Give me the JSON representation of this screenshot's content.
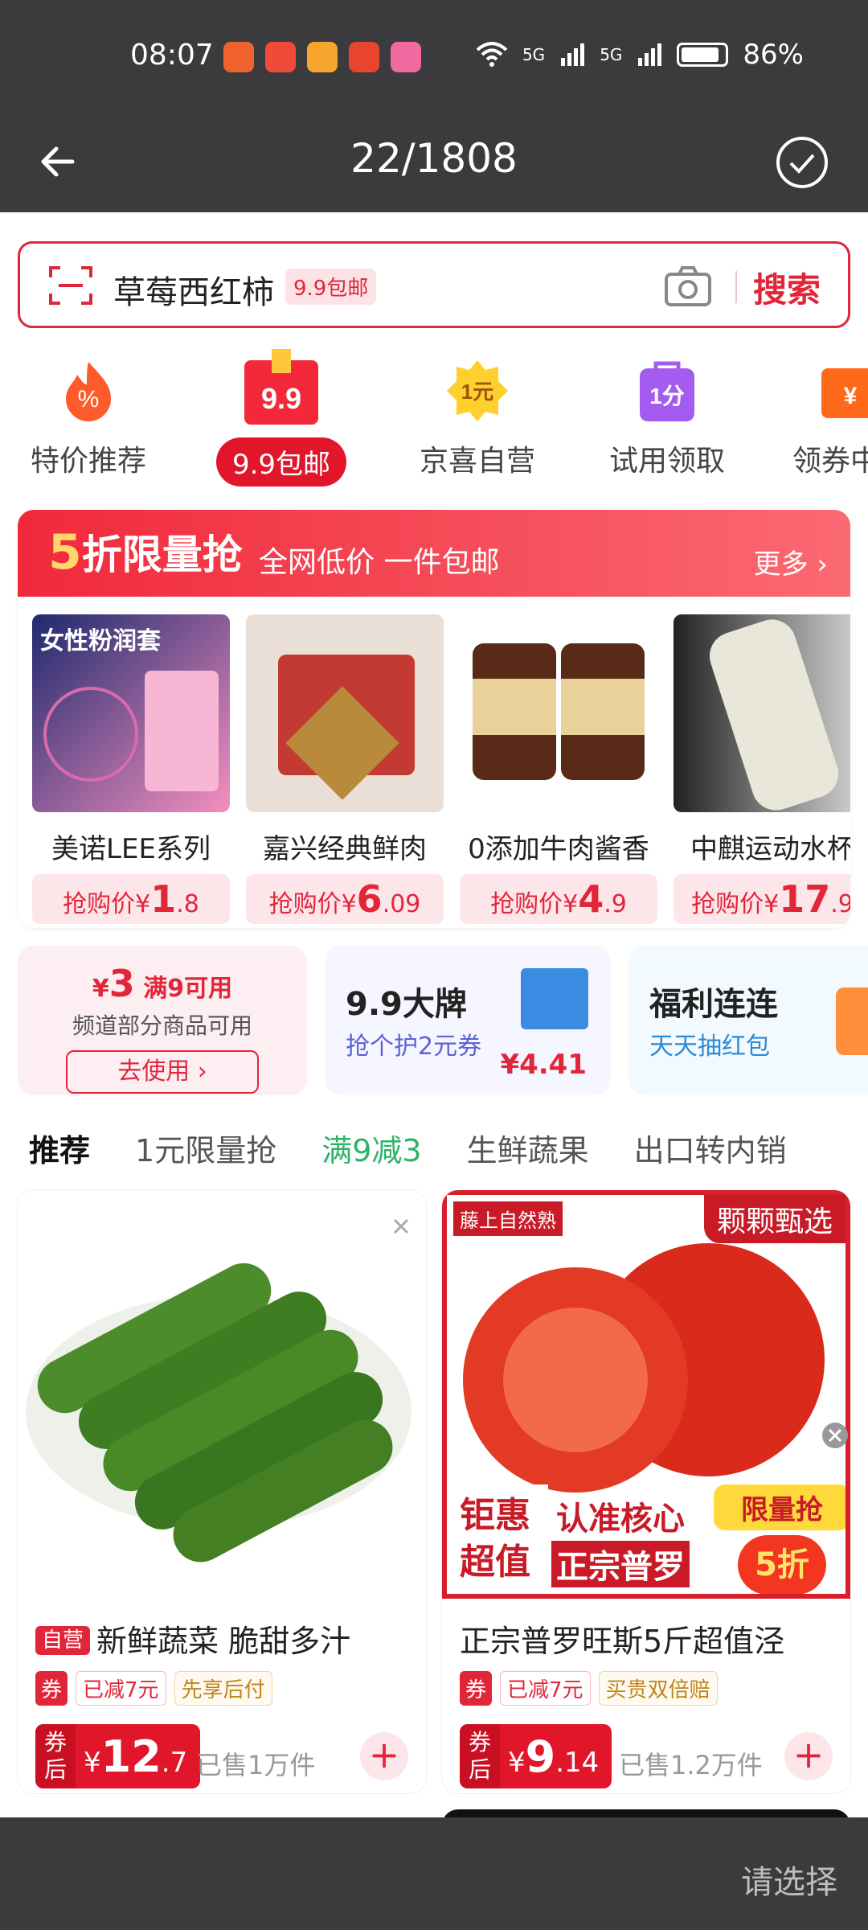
{
  "status_bar": {
    "time": "08:07",
    "network_1": "5G",
    "network_2": "5G",
    "battery": "86%"
  },
  "title_bar": {
    "back_icon": "arrow-left-icon",
    "counter": "22/1808",
    "confirm_icon": "check-circle-icon"
  },
  "search": {
    "query": "草莓西红柿",
    "tag": "9.9包邮",
    "button": "搜索"
  },
  "categories": [
    {
      "label": "特价推荐",
      "icon": "percent-fire-icon"
    },
    {
      "label": "9.9包邮",
      "icon": "gift-box-icon",
      "active": true
    },
    {
      "label": "京喜自营",
      "icon": "one-yuan-badge-icon"
    },
    {
      "label": "试用领取",
      "icon": "bag-icon"
    },
    {
      "label": "领券中",
      "icon": "coupon-icon"
    }
  ],
  "flash_sale": {
    "title_num": "5",
    "title": "折限量抢",
    "subtitle": "全网低价 一件包邮",
    "more": "更多 ›",
    "price_prefix": "抢购价",
    "currency": "¥",
    "products": [
      {
        "name": "美诺LEE系列",
        "price_int": "1",
        "price_dec": ".8"
      },
      {
        "name": "嘉兴经典鲜肉",
        "price_int": "6",
        "price_dec": ".09"
      },
      {
        "name": "0添加牛肉酱香",
        "price_int": "4",
        "price_dec": ".9"
      },
      {
        "name": "中麒运动水杯",
        "price_int": "17",
        "price_dec": ".9"
      }
    ]
  },
  "promos": {
    "coupon": {
      "line1_amount": "3",
      "line1": "满9可用",
      "line2": "频道部分商品可用",
      "button": "去使用 ›"
    },
    "brand": {
      "title": "9.9大牌",
      "subtitle": "抢个护2元券",
      "price": "¥4.41"
    },
    "welfare": {
      "title": "福利连连",
      "subtitle": "天天抽红包"
    }
  },
  "tabs": [
    "推荐",
    "1元限量抢",
    "满9减3",
    "生鲜蔬果",
    "出口转内销"
  ],
  "products": [
    {
      "self_tag": "自营",
      "title": "新鲜蔬菜 脆甜多汁",
      "coupon_tag": "券",
      "discount": "已减7元",
      "extra_tag": "先享后付",
      "price_label": "券后",
      "price_int": "12",
      "price_dec": ".7",
      "sold": "已售1万件"
    },
    {
      "title": "正宗普罗旺斯5斤超值泾",
      "badge_top_left": "藤上自然熟",
      "badge_top_right": "颗颗甄选",
      "img_text1": "钜惠",
      "img_text2": "超值",
      "img_text3": "认准核心",
      "img_text4": "正宗普罗",
      "limit_badge": "限量抢",
      "limit_badge2": "5折",
      "coupon_tag": "券",
      "discount": "已减7元",
      "extra_tag": "买贵双倍赔",
      "price_label": "券后",
      "price_int": "9",
      "price_dec": ".14",
      "sold": "已售1.2万件"
    }
  ],
  "bottom_bar": {
    "select": "请选择"
  }
}
